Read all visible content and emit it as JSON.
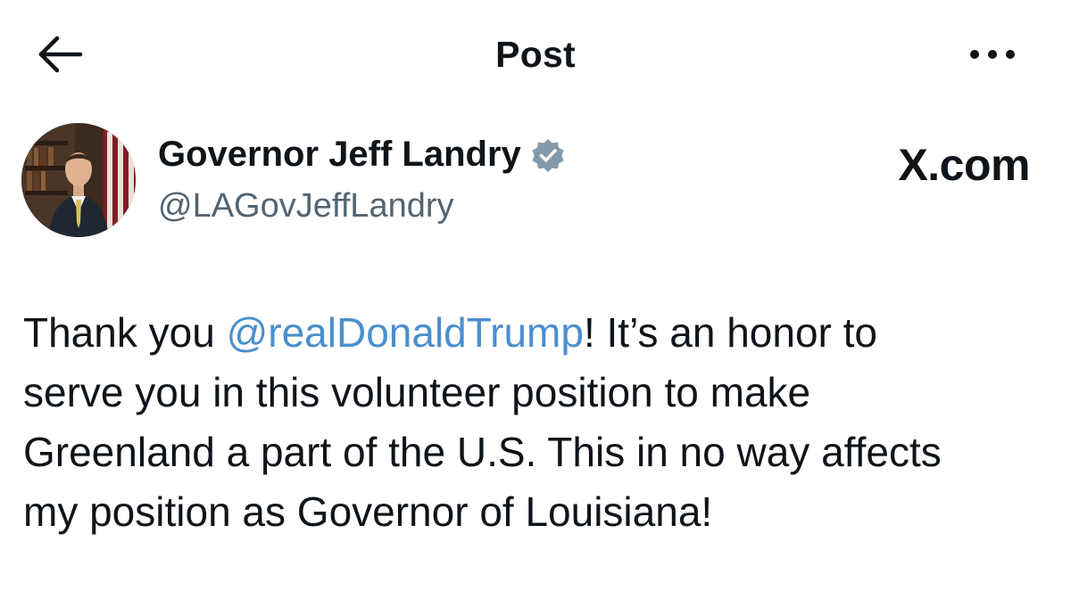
{
  "header": {
    "title": "Post",
    "back_icon": "arrow-left-icon",
    "more_icon": "more-horizontal-icon"
  },
  "author": {
    "display_name": "Governor Jeff Landry",
    "handle": "@LAGovJeffLandry",
    "verified_icon": "verified-badge-icon",
    "verified_color": "#829aab"
  },
  "watermark": "X.com",
  "post": {
    "line1_before": "Thank you ",
    "mention": "@realDonaldTrump",
    "line1_after": "! It’s an honor to",
    "line2": "serve you in this volunteer position to make",
    "line3": "Greenland a part of the U.S. This in no way affects",
    "line4": "my position as Governor of Louisiana!"
  },
  "colors": {
    "text": "#0f1419",
    "secondary": "#536471",
    "mention": "#4a8fcf"
  }
}
